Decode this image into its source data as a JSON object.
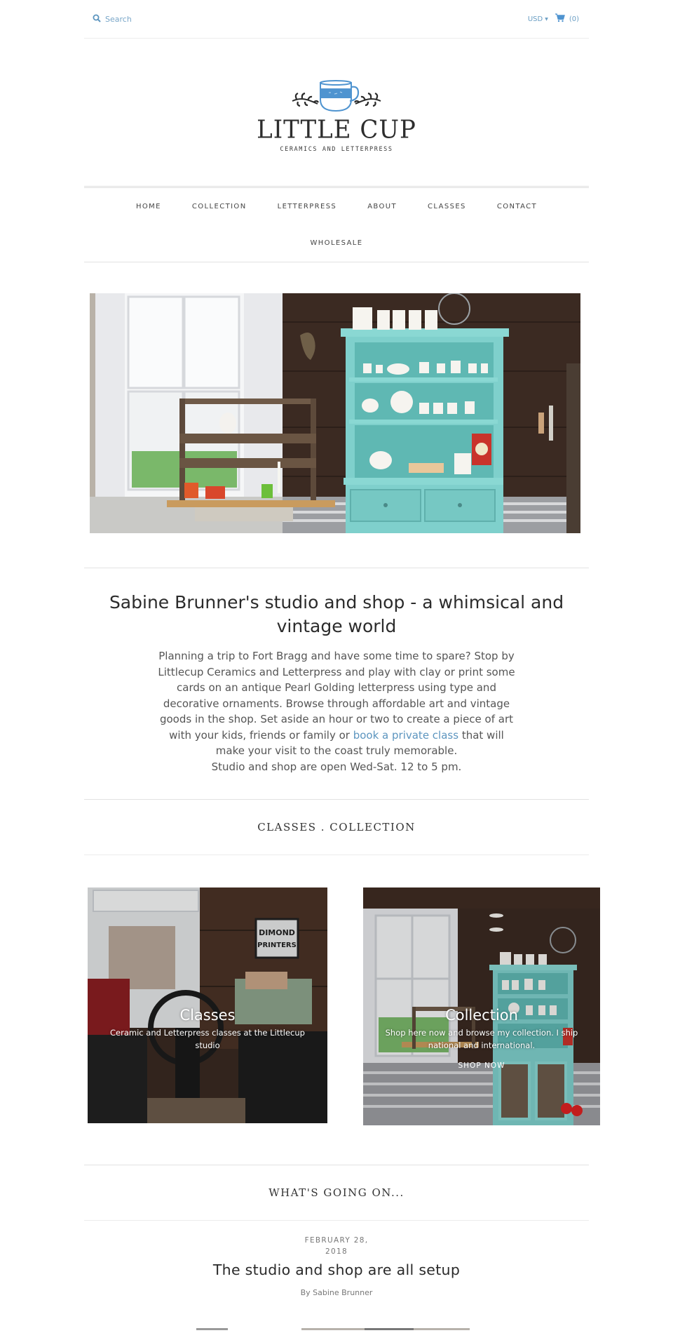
{
  "topbar": {
    "search_placeholder": "Search",
    "currency": "USD",
    "cart_count": "(0)"
  },
  "logo": {
    "title": "LITTLE CUP",
    "subtitle": "CERAMICS AND LETTERPRESS"
  },
  "nav": {
    "row1": [
      "HOME",
      "COLLECTION",
      "LETTERPRESS",
      "ABOUT",
      "CLASSES",
      "CONTACT"
    ],
    "row2": [
      "WHOLESALE"
    ]
  },
  "intro": {
    "title": "Sabine Brunner's studio and shop - a whimsical and vintage world",
    "body_before_link": "Planning a trip to Fort Bragg and have some time to spare? Stop by Littlecup Ceramics and Letterpress and play with clay or print some cards on an antique Pearl Golding letterpress using type and decorative ornaments. Browse through affordable art and vintage goods in the shop. Set aside an hour or two to create a piece of art with your kids, friends or family or ",
    "link_text": "book a private class",
    "body_after_link": " that will make your visit to the coast truly memorable.",
    "hours": "Studio and shop are open Wed-Sat. 12 to 5 pm."
  },
  "featured": {
    "heading": "CLASSES . COLLECTION",
    "tiles": [
      {
        "title": "Classes",
        "description": "Ceramic and Letterpress classes at the Littlecup studio",
        "cta": ""
      },
      {
        "title": "Collection",
        "description": "Shop here now and browse my collection. I ship national and international.",
        "cta": "SHOP NOW"
      }
    ]
  },
  "blog": {
    "heading": "WHAT'S GOING ON...",
    "post": {
      "date": "FEBRUARY 28, 2018",
      "title": "The studio and shop are all setup",
      "author": "By Sabine Brunner"
    }
  },
  "colors": {
    "accent": "#5c95bf",
    "cup_blue": "#4f94d0",
    "cabinet_teal": "#7fd0cc",
    "wood_dark": "#3b2a22"
  }
}
